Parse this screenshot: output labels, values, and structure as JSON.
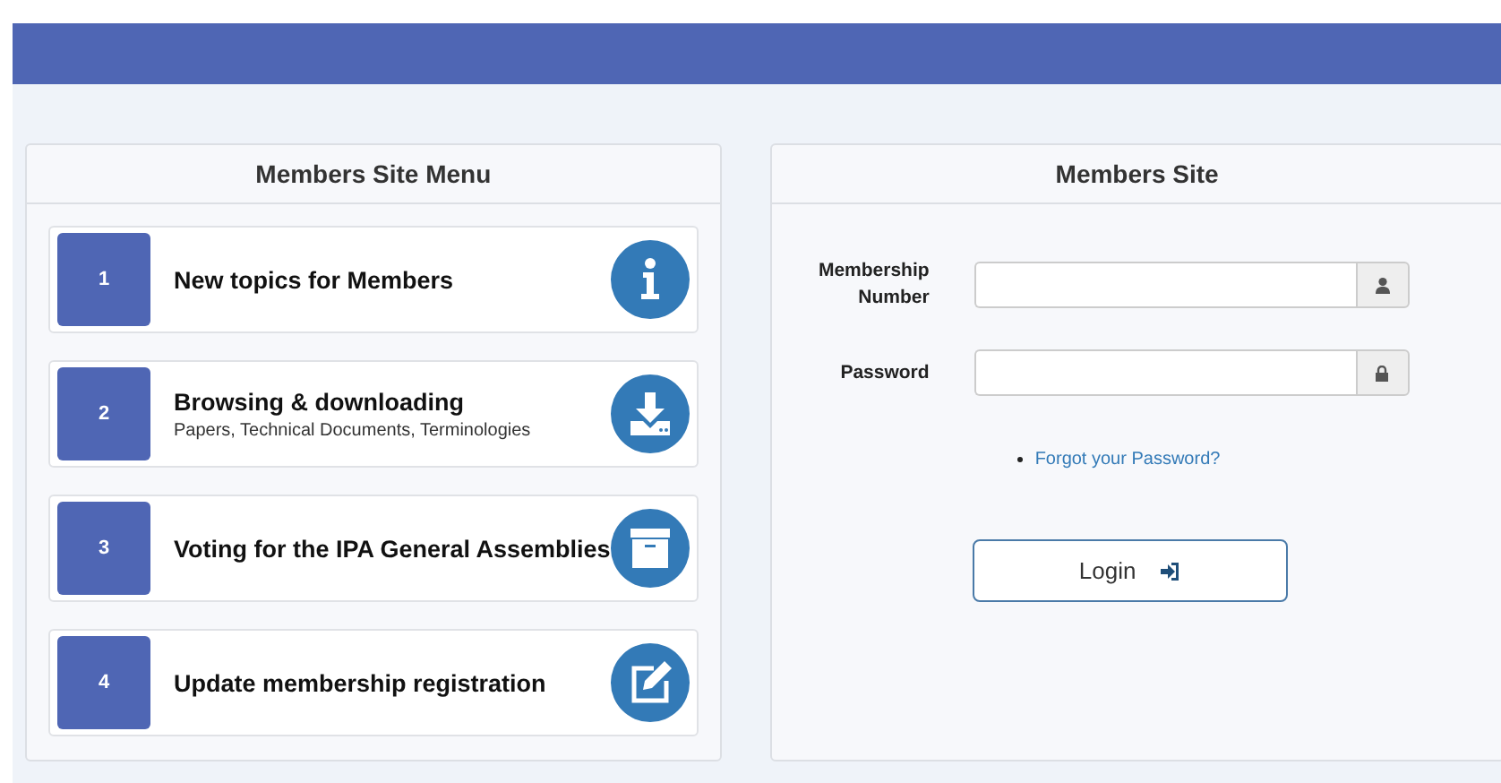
{
  "menu": {
    "title": "Members Site Menu",
    "items": [
      {
        "number": "1",
        "title": "New topics for Members"
      },
      {
        "number": "2",
        "title": "Browsing & downloading",
        "subtitle": "Papers, Technical Documents, Terminologies"
      },
      {
        "number": "3",
        "title": "Voting for the IPA General Assemblies"
      },
      {
        "number": "4",
        "title": "Update membership registration"
      }
    ]
  },
  "login": {
    "title": "Members Site",
    "fields": [
      {
        "label": "Membership Number",
        "kind": "text"
      },
      {
        "label": "Password",
        "kind": "password"
      }
    ],
    "link": "Forgot your Password?",
    "button": "Login"
  }
}
